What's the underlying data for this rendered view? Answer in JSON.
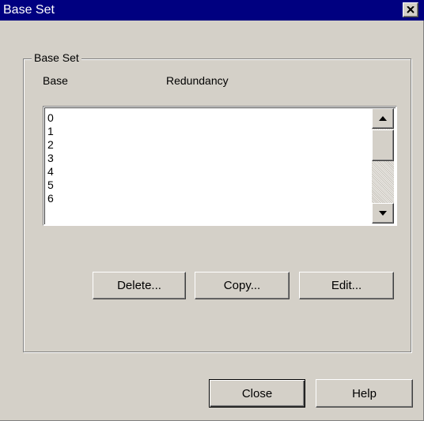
{
  "window": {
    "title": "Base Set"
  },
  "group": {
    "label": "Base Set"
  },
  "columns": {
    "base": "Base",
    "redundancy": "Redundancy"
  },
  "list": {
    "items": [
      "0",
      "1",
      "2",
      "3",
      "4",
      "5",
      "6"
    ]
  },
  "buttons": {
    "delete": "Delete...",
    "copy": "Copy...",
    "edit": "Edit...",
    "close": "Close",
    "help": "Help"
  },
  "icons": {
    "close": "close-icon",
    "scroll_up": "scroll-up-arrow-icon",
    "scroll_down": "scroll-down-arrow-icon"
  },
  "colors": {
    "titlebar": "#000080",
    "face": "#d4d0c8"
  }
}
